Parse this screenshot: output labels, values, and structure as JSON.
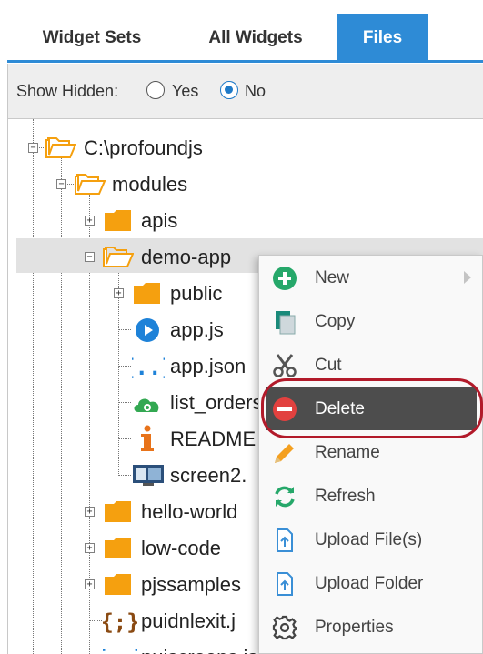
{
  "tabs": [
    {
      "label": "Widget Sets",
      "active": false
    },
    {
      "label": "All Widgets",
      "active": false
    },
    {
      "label": "Files",
      "active": true
    }
  ],
  "show_hidden": {
    "label": "Show Hidden:",
    "options": [
      {
        "label": "Yes",
        "checked": false
      },
      {
        "label": "No",
        "checked": true
      }
    ]
  },
  "tree": [
    {
      "label": "C:\\profoundjs",
      "icon": "folder-open-icon",
      "toggle": "−"
    },
    {
      "label": "modules",
      "icon": "folder-open-icon",
      "toggle": "−"
    },
    {
      "label": "apis",
      "icon": "folder-icon",
      "toggle": "+"
    },
    {
      "label": "demo-app",
      "icon": "folder-open-icon",
      "toggle": "−",
      "selected": true
    },
    {
      "label": "public",
      "icon": "folder-icon",
      "toggle": "+"
    },
    {
      "label": "app.js",
      "icon": "play-circle-icon"
    },
    {
      "label": "app.json",
      "icon": "json-braces-icon"
    },
    {
      "label": "list_orders",
      "icon": "cloud-gear-icon"
    },
    {
      "label": "README",
      "icon": "info-icon"
    },
    {
      "label": "screen2.",
      "icon": "monitor-icon"
    },
    {
      "label": "hello-world",
      "icon": "folder-icon",
      "toggle": "+"
    },
    {
      "label": "low-code",
      "icon": "folder-icon",
      "toggle": "+"
    },
    {
      "label": "pjssamples",
      "icon": "folder-icon",
      "toggle": "+"
    },
    {
      "label": "puidnlexit.j",
      "icon": "js-braces-icon"
    },
    {
      "label": "puiscreens.json",
      "icon": "json-braces-icon"
    }
  ],
  "context_menu": [
    {
      "label": "New",
      "icon": "plus-circle-icon",
      "submenu": true
    },
    {
      "label": "Copy",
      "icon": "copy-icon"
    },
    {
      "label": "Cut",
      "icon": "scissors-icon"
    },
    {
      "label": "Delete",
      "icon": "minus-circle-icon",
      "active": true
    },
    {
      "label": "Rename",
      "icon": "pencil-icon"
    },
    {
      "label": "Refresh",
      "icon": "refresh-icon"
    },
    {
      "label": "Upload File(s)",
      "icon": "upload-file-icon"
    },
    {
      "label": "Upload Folder",
      "icon": "upload-folder-icon"
    },
    {
      "label": "Properties",
      "icon": "gear-icon"
    }
  ],
  "colors": {
    "accent": "#2e8bd6",
    "folder": "#f5a00f",
    "menu_active_bg": "#4d4d4d",
    "delete_red": "#e2413f",
    "new_green": "#26a86a",
    "highlight_ring": "#b21a2a"
  }
}
